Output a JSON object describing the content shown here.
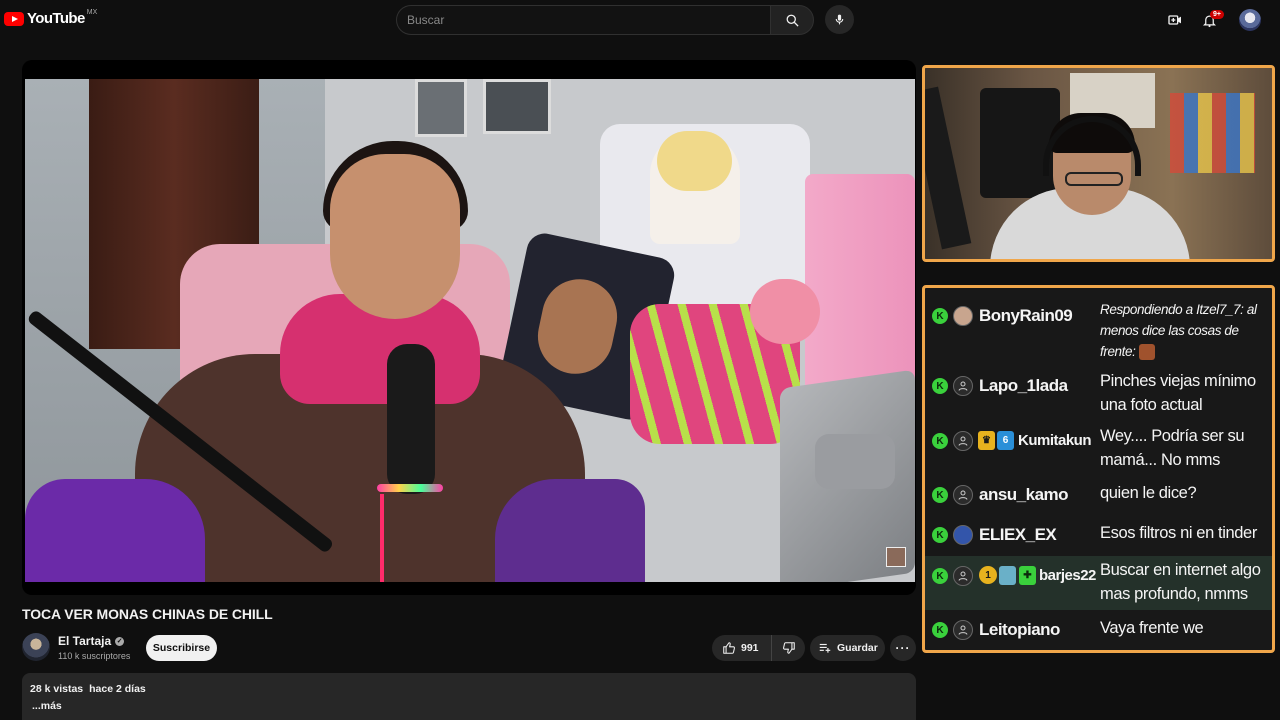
{
  "header": {
    "logo_text": "YouTube",
    "logo_region": "MX",
    "search_placeholder": "Buscar",
    "notification_count": "9+",
    "icons": [
      "search-icon",
      "mic-icon",
      "create-icon",
      "bell-icon",
      "avatar"
    ]
  },
  "video": {
    "title": "TOCA VER MONAS CHINAS DE CHILL",
    "channel_name": "El Tartaja",
    "subscribers": "110 k suscriptores",
    "subscribe_label": "Suscribirse",
    "likes": "991",
    "save_label": "Guardar",
    "more_label": "···",
    "views": "28 k vistas",
    "date": "hace 2 días",
    "more_text": "...más"
  },
  "chat": {
    "messages": [
      {
        "user": "BonyRain09",
        "text": "Respondiendo a Itzel7_7: al menos dice las cosas de frente:",
        "reply": true
      },
      {
        "user": "Lapo_1lada",
        "text": "Pinches viejas mínimo una foto actual"
      },
      {
        "user": "Kumitakun",
        "text": "Wey.... Podría ser su mamá... No mms"
      },
      {
        "user": "ansu_kamo",
        "text": "quien le dice?"
      },
      {
        "user": "ELIEX_EX",
        "text": "Esos filtros ni en tinder"
      },
      {
        "user": "barjes22",
        "text": "Buscar en internet algo mas profundo, nmms",
        "highlight": true
      },
      {
        "user": "Leitopiano",
        "text": "Vaya frente we"
      }
    ],
    "badge_glyph": "K",
    "badge_color": "#3ad13c",
    "border_color": "#f0a64a"
  },
  "colors": {
    "background": "#0f0f0f",
    "surface": "#272727",
    "youtube_red": "#ff0000"
  }
}
